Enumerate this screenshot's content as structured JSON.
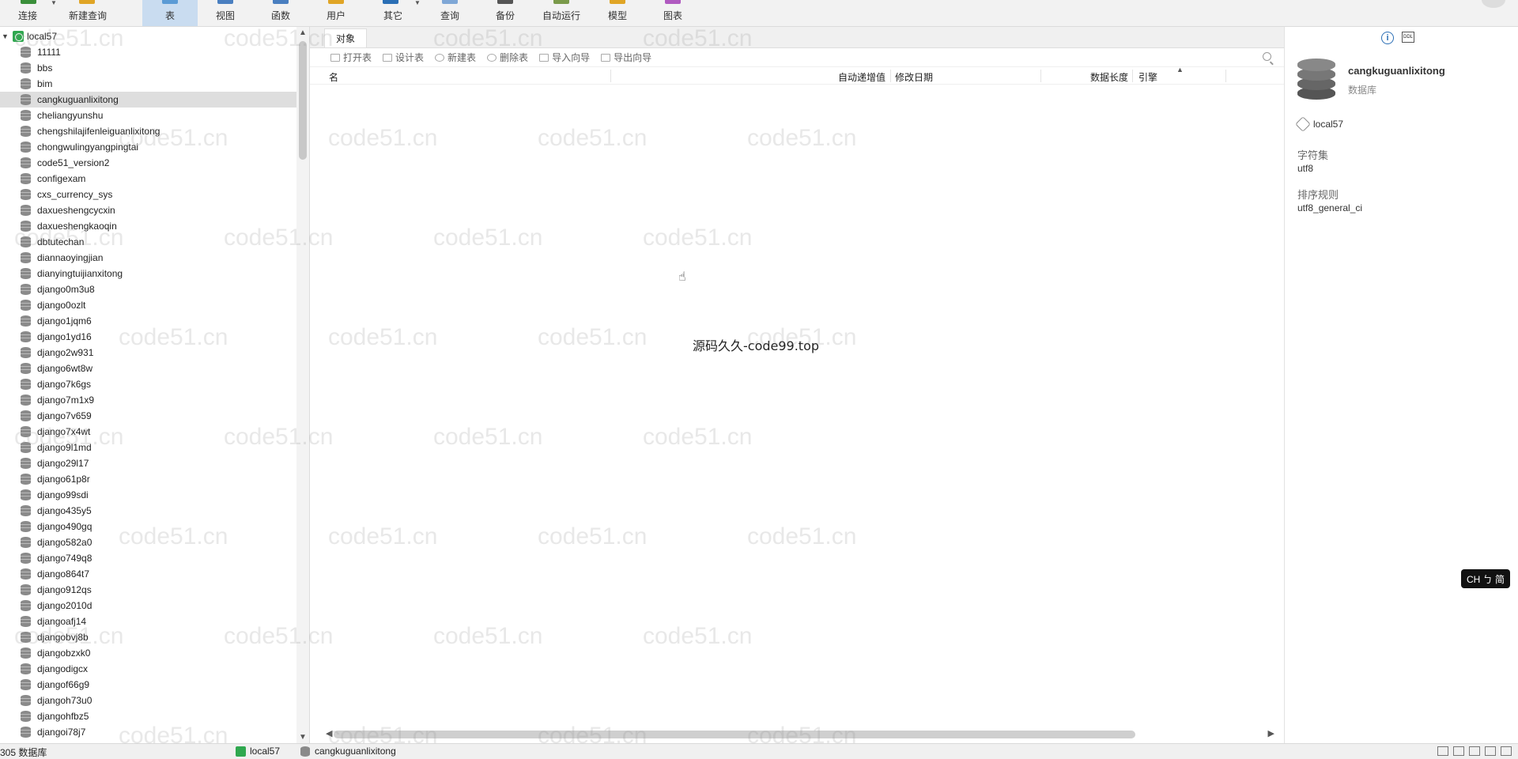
{
  "toolbar": {
    "buttons": [
      {
        "label": "连接",
        "icon": "connect-icon"
      },
      {
        "label": "新建查询",
        "icon": "new-query-icon"
      },
      {
        "label": "表",
        "icon": "table-icon"
      },
      {
        "label": "视图",
        "icon": "view-icon"
      },
      {
        "label": "函数",
        "icon": "function-icon"
      },
      {
        "label": "用户",
        "icon": "user-icon"
      },
      {
        "label": "其它",
        "icon": "other-icon"
      },
      {
        "label": "查询",
        "icon": "query-icon"
      },
      {
        "label": "备份",
        "icon": "backup-icon"
      },
      {
        "label": "自动运行",
        "icon": "autorun-icon"
      },
      {
        "label": "模型",
        "icon": "model-icon"
      },
      {
        "label": "图表",
        "icon": "chart-icon"
      }
    ]
  },
  "sidebar": {
    "connection": "local57",
    "databases": [
      "11111",
      "bbs",
      "bim",
      "cangkuguanlixitong",
      "cheliangyunshu",
      "chengshilajifenleiguanlixitong",
      "chongwulingyangpingtai",
      "code51_version2",
      "configexam",
      "cxs_currency_sys",
      "daxueshengcycxin",
      "daxueshengkaoqin",
      "dbtutechan",
      "diannaoyingjian",
      "dianyingtuijianxitong",
      "django0m3u8",
      "django0ozlt",
      "django1jqm6",
      "django1yd16",
      "django2w931",
      "django6wt8w",
      "django7k6gs",
      "django7m1x9",
      "django7v659",
      "django7x4wt",
      "django9l1md",
      "django29l17",
      "django61p8r",
      "django99sdi",
      "django435y5",
      "django490gq",
      "django582a0",
      "django749q8",
      "django864t7",
      "django912qs",
      "django2010d",
      "djangoafj14",
      "djangobvj8b",
      "djangobzxk0",
      "djangodigcx",
      "djangof66g9",
      "djangoh73u0",
      "djangohfbz5",
      "djangoi78j7"
    ]
  },
  "main": {
    "tab": "对象",
    "actions": [
      "打开表",
      "设计表",
      "新建表",
      "删除表",
      "导入向导",
      "导出向导"
    ],
    "columns": [
      "名",
      "自动递增值",
      "修改日期",
      "数据长度",
      "引擎"
    ],
    "center_text": "源码久久-code99.top"
  },
  "details": {
    "db_name": "cangkuguanlixitong",
    "db_type": "数据库",
    "connection": "local57",
    "charset_label": "字符集",
    "charset_value": "utf8",
    "collation_label": "排序规则",
    "collation_value": "utf8_general_ci"
  },
  "ime": {
    "text": "CH ㄅ 简"
  },
  "statusbar": {
    "count_text": "305 数据库",
    "connection": "local57",
    "database": "cangkuguanlixitong"
  },
  "watermark": {
    "text": "code51.cn"
  },
  "colors": {
    "accent_active": "#c9dcf0",
    "connection_green": "#2fa84f",
    "info_blue": "#2b6fb5"
  }
}
